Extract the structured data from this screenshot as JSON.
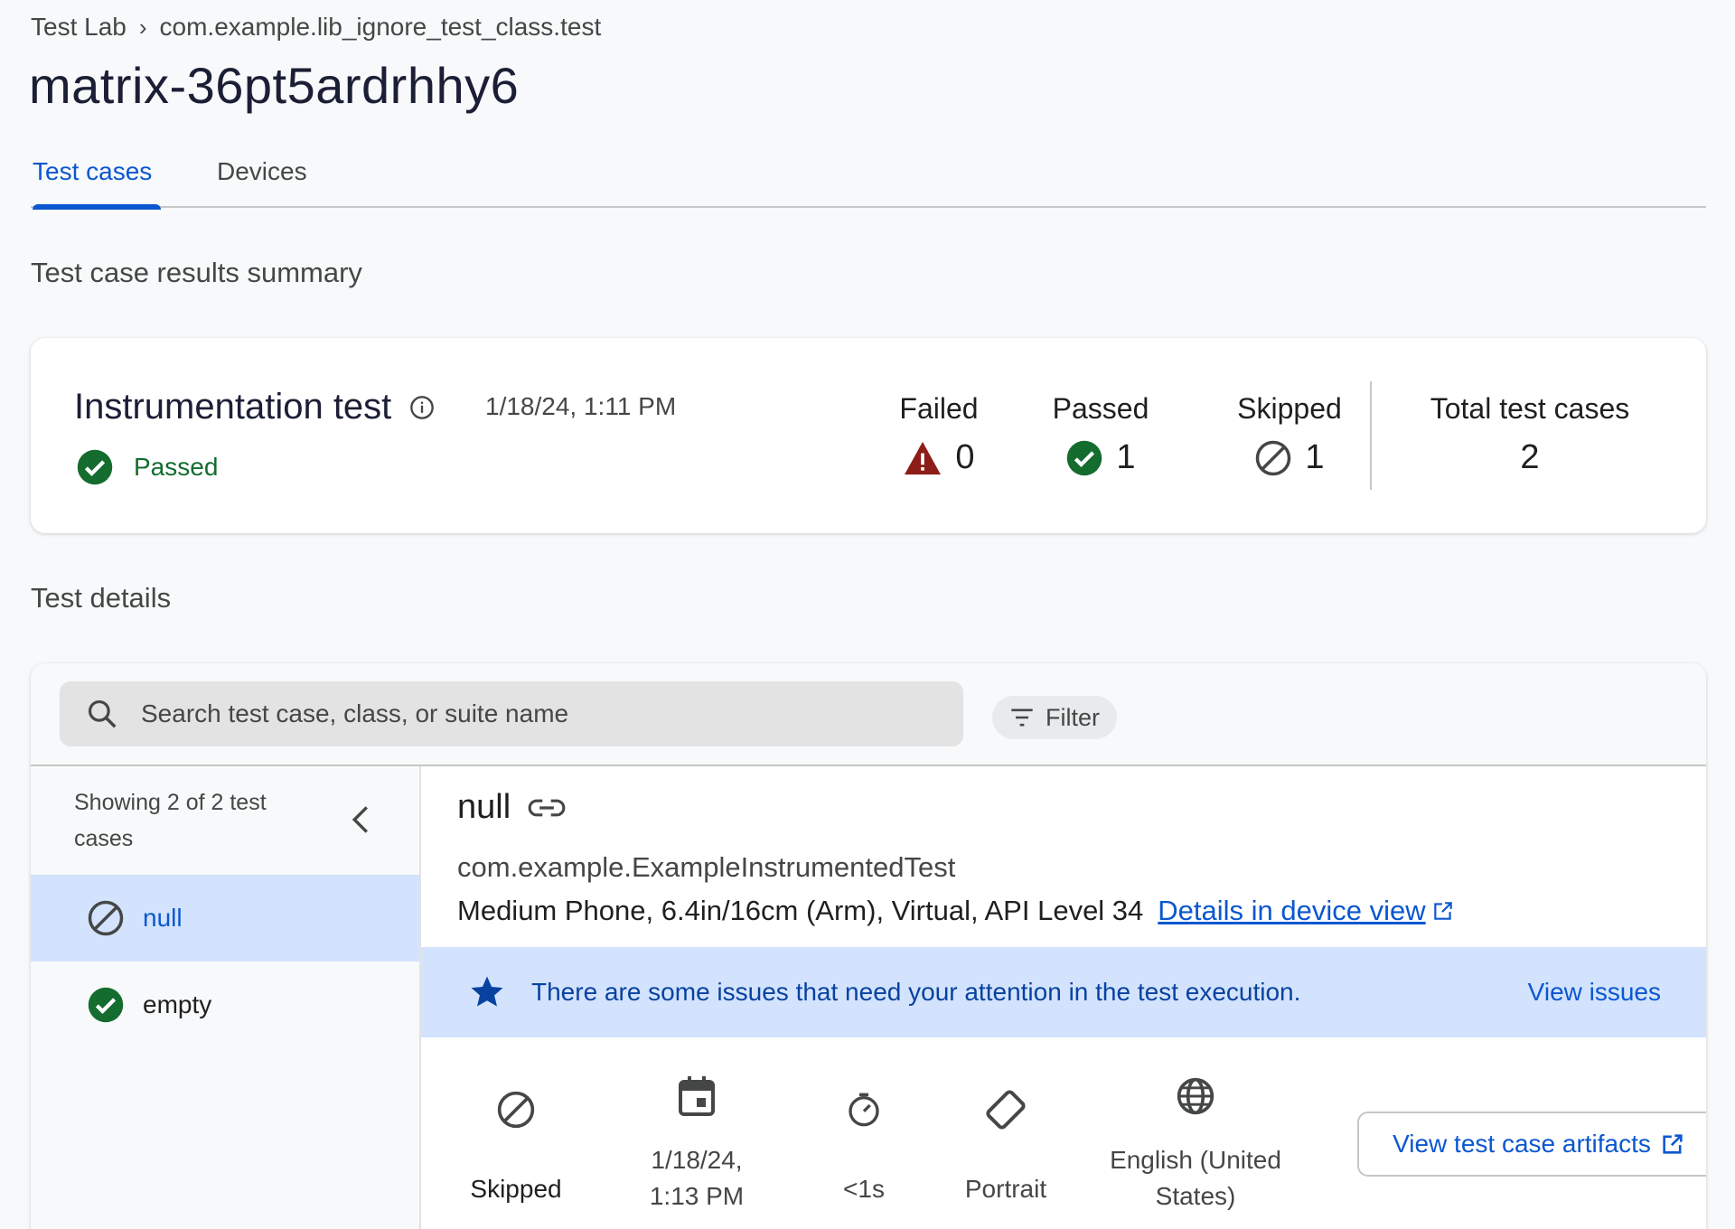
{
  "breadcrumb": {
    "root": "Test Lab",
    "separator": "›",
    "current": "com.example.lib_ignore_test_class.test"
  },
  "page_title": "matrix-36pt5ardrhhy6",
  "tabs": [
    {
      "label": "Test cases",
      "active": true
    },
    {
      "label": "Devices",
      "active": false
    }
  ],
  "summary": {
    "section_title": "Test case results summary",
    "test_type": "Instrumentation test",
    "date": "1/18/24, 1:11 PM",
    "status": "Passed",
    "failed": {
      "label": "Failed",
      "value": "0"
    },
    "passed": {
      "label": "Passed",
      "value": "1"
    },
    "skipped": {
      "label": "Skipped",
      "value": "1"
    },
    "total": {
      "label": "Total test cases",
      "value": "2"
    }
  },
  "details": {
    "section_title": "Test details",
    "search_placeholder": "Search test case, class, or suite name",
    "filter_label": "Filter",
    "showing": "Showing 2 of 2 test cases",
    "test_cases": [
      {
        "name": "null",
        "status": "skipped",
        "selected": true
      },
      {
        "name": "empty",
        "status": "passed",
        "selected": false
      }
    ],
    "selected": {
      "name": "null",
      "class": "com.example.ExampleInstrumentedTest",
      "device": "Medium Phone, 6.4in/16cm (Arm), Virtual, API Level 34",
      "device_link": "Details in device view",
      "banner_message": "There are some issues that need your attention in the test execution.",
      "banner_action": "View issues",
      "meta": {
        "status": "Skipped",
        "date_line1": "1/18/24,",
        "date_line2": "1:13 PM",
        "duration": "<1s",
        "orientation": "Portrait",
        "locale_line1": "English (United",
        "locale_line2": "States)"
      },
      "artifacts_button": "View test case artifacts"
    }
  },
  "colors": {
    "accent": "#0b57d0",
    "pass": "#146c2e",
    "fail": "#8c1d18",
    "banner": "#d3e3fd"
  }
}
